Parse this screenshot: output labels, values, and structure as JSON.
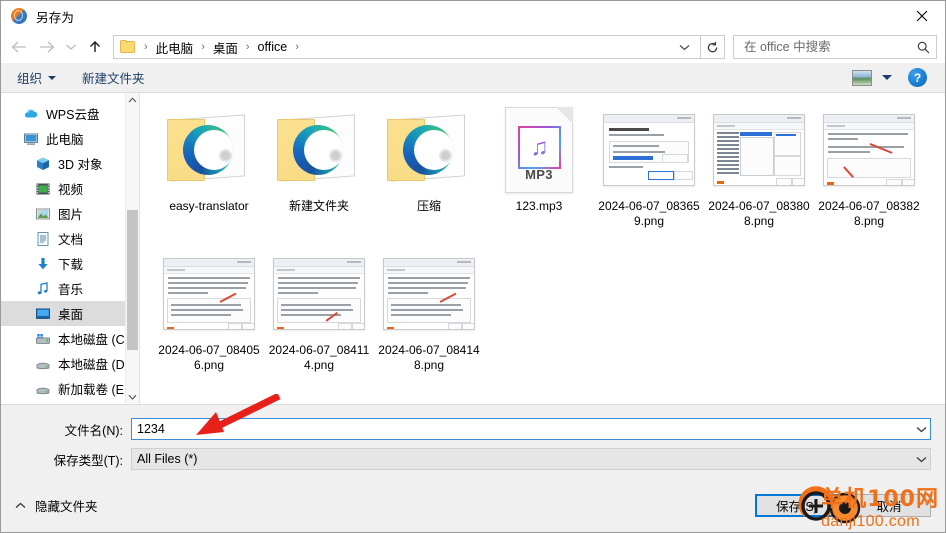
{
  "window": {
    "title": "另存为",
    "title_icon": "globe-icon",
    "close_label": "✕"
  },
  "navigation": {
    "back_icon": "arrow-left-icon",
    "forward_icon": "arrow-right-icon",
    "history_icon": "chevron-down-icon",
    "up_icon": "arrow-up-icon",
    "refresh_icon": "refresh-icon",
    "breadcrumb": {
      "folder_icon": "folder-icon",
      "parts": [
        "此电脑",
        "桌面",
        "office"
      ],
      "separator": "›",
      "caret_icon": "chevron-down-icon"
    }
  },
  "search": {
    "placeholder": "在 office 中搜索",
    "value": "",
    "icon": "search-icon"
  },
  "toolbar": {
    "organize_label": "组织",
    "new_folder_label": "新建文件夹",
    "view_icon": "view-thumbnails-icon",
    "view_caret_icon": "chevron-down-icon",
    "help_label": "?",
    "help_icon": "help-icon"
  },
  "sidebar": {
    "items": [
      {
        "label": "WPS云盘",
        "icon": "cloud-icon",
        "indent": false,
        "selected": false
      },
      {
        "label": "此电脑",
        "icon": "computer-icon",
        "indent": false,
        "selected": false
      },
      {
        "label": "3D 对象",
        "icon": "3d-objects-icon",
        "indent": true,
        "selected": false
      },
      {
        "label": "视频",
        "icon": "videos-icon",
        "indent": true,
        "selected": false
      },
      {
        "label": "图片",
        "icon": "pictures-icon",
        "indent": true,
        "selected": false
      },
      {
        "label": "文档",
        "icon": "documents-icon",
        "indent": true,
        "selected": false
      },
      {
        "label": "下载",
        "icon": "downloads-icon",
        "indent": true,
        "selected": false
      },
      {
        "label": "音乐",
        "icon": "music-icon",
        "indent": true,
        "selected": false
      },
      {
        "label": "桌面",
        "icon": "desktop-icon",
        "indent": true,
        "selected": true
      },
      {
        "label": "本地磁盘 (C:)",
        "icon": "system-drive-icon",
        "indent": true,
        "selected": false
      },
      {
        "label": "本地磁盘 (D:)",
        "icon": "drive-icon",
        "indent": true,
        "selected": false
      },
      {
        "label": "新加载卷 (E:)",
        "icon": "drive-icon",
        "indent": true,
        "selected": false
      }
    ],
    "scrollbar": {
      "up_arrow": "chevron-up-icon",
      "down_arrow": "chevron-down-icon"
    }
  },
  "files": [
    {
      "name": "easy-translator",
      "type": "folder"
    },
    {
      "name": "新建文件夹",
      "type": "folder"
    },
    {
      "name": "压缩",
      "type": "folder"
    },
    {
      "name": "123.mp3",
      "type": "mp3",
      "badge": "MP3"
    },
    {
      "name": "2024-06-07_083659.png",
      "type": "png",
      "variant": "dialog"
    },
    {
      "name": "2024-06-07_083808.png",
      "type": "png",
      "variant": "tree"
    },
    {
      "name": "2024-06-07_083828.png",
      "type": "png",
      "variant": "text"
    },
    {
      "name": "2024-06-07_084056.png",
      "type": "png",
      "variant": "text2"
    },
    {
      "name": "2024-06-07_084114.png",
      "type": "png",
      "variant": "text2"
    },
    {
      "name": "2024-06-07_084148.png",
      "type": "png",
      "variant": "text2"
    }
  ],
  "form": {
    "filename_label": "文件名(N):",
    "filename_value": "1234",
    "filetype_label": "保存类型(T):",
    "filetype_value": "All Files (*)",
    "caret_icon": "chevron-down-icon"
  },
  "footer": {
    "hide_folders_label": "隐藏文件夹",
    "hide_folders_icon": "chevron-up-icon",
    "save_label": "保存(S)",
    "cancel_label": "取消"
  },
  "annotations": {
    "arrow_color": "#e8201a",
    "watermark_top": "单机100网",
    "watermark_bottom": "danji100.com",
    "watermark_color": "#f0701a"
  }
}
